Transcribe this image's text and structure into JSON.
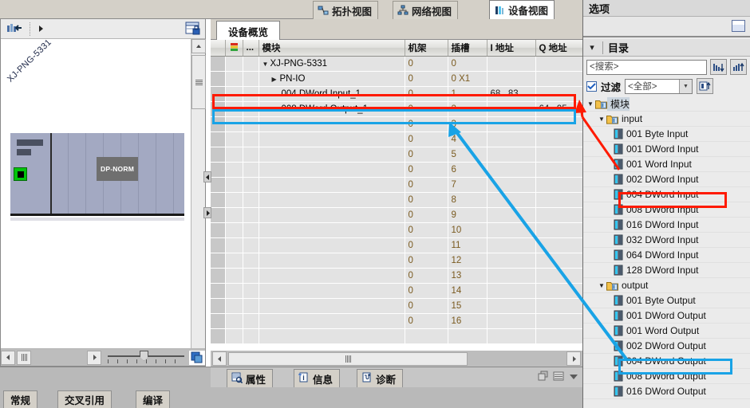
{
  "view_tabs": [
    {
      "label": "拓扑视图",
      "icon": "topology-icon",
      "active": false
    },
    {
      "label": "网络视图",
      "icon": "network-icon",
      "active": false
    },
    {
      "label": "设备视图",
      "icon": "device-icon",
      "active": true
    }
  ],
  "left_pane": {
    "toolbar": {
      "device_select_icon": "device-select-icon",
      "expand_arrow_icon": "right-arrow-icon",
      "lock_icon": "window-lock-icon"
    },
    "device_label": "XJ-PNG-5331",
    "module_label": "DP-NORM",
    "zoom_slider_value": "100"
  },
  "center": {
    "tab_label": "设备概览",
    "columns": [
      {
        "key": "gutter",
        "label": ""
      },
      {
        "key": "flag",
        "label": "",
        "icon": "traffic-light-icon"
      },
      {
        "key": "dots",
        "label": "..."
      },
      {
        "key": "module",
        "label": "模块"
      },
      {
        "key": "rack",
        "label": "机架"
      },
      {
        "key": "slot",
        "label": "插槽"
      },
      {
        "key": "iaddr",
        "label": "I 地址"
      },
      {
        "key": "qaddr",
        "label": "Q 地址"
      }
    ],
    "rows": [
      {
        "module": "XJ-PNG-5331",
        "rack": "0",
        "slot": "0",
        "iaddr": "",
        "qaddr": "",
        "indent": 1,
        "toggle": "expanded",
        "highlight": "none"
      },
      {
        "module": "PN-IO",
        "rack": "0",
        "slot": "0 X1",
        "iaddr": "",
        "qaddr": "",
        "indent": 2,
        "toggle": "collapsed",
        "highlight": "none"
      },
      {
        "module": "004 DWord Input_1",
        "rack": "0",
        "slot": "1",
        "iaddr": "68...83",
        "qaddr": "",
        "indent": 3,
        "toggle": "none",
        "highlight": "red"
      },
      {
        "module": "008 DWord Output_1",
        "rack": "0",
        "slot": "2",
        "iaddr": "",
        "qaddr": "64...95",
        "indent": 3,
        "toggle": "none",
        "highlight": "blue"
      },
      {
        "module": "",
        "rack": "0",
        "slot": "3",
        "iaddr": "",
        "qaddr": "",
        "indent": 3,
        "toggle": "none",
        "highlight": "none"
      },
      {
        "module": "",
        "rack": "0",
        "slot": "4",
        "iaddr": "",
        "qaddr": "",
        "indent": 3,
        "toggle": "none",
        "highlight": "none"
      },
      {
        "module": "",
        "rack": "0",
        "slot": "5",
        "iaddr": "",
        "qaddr": "",
        "indent": 3,
        "toggle": "none",
        "highlight": "none"
      },
      {
        "module": "",
        "rack": "0",
        "slot": "6",
        "iaddr": "",
        "qaddr": "",
        "indent": 3,
        "toggle": "none",
        "highlight": "none"
      },
      {
        "module": "",
        "rack": "0",
        "slot": "7",
        "iaddr": "",
        "qaddr": "",
        "indent": 3,
        "toggle": "none",
        "highlight": "none"
      },
      {
        "module": "",
        "rack": "0",
        "slot": "8",
        "iaddr": "",
        "qaddr": "",
        "indent": 3,
        "toggle": "none",
        "highlight": "none"
      },
      {
        "module": "",
        "rack": "0",
        "slot": "9",
        "iaddr": "",
        "qaddr": "",
        "indent": 3,
        "toggle": "none",
        "highlight": "none"
      },
      {
        "module": "",
        "rack": "0",
        "slot": "10",
        "iaddr": "",
        "qaddr": "",
        "indent": 3,
        "toggle": "none",
        "highlight": "none"
      },
      {
        "module": "",
        "rack": "0",
        "slot": "11",
        "iaddr": "",
        "qaddr": "",
        "indent": 3,
        "toggle": "none",
        "highlight": "none"
      },
      {
        "module": "",
        "rack": "0",
        "slot": "12",
        "iaddr": "",
        "qaddr": "",
        "indent": 3,
        "toggle": "none",
        "highlight": "none"
      },
      {
        "module": "",
        "rack": "0",
        "slot": "13",
        "iaddr": "",
        "qaddr": "",
        "indent": 3,
        "toggle": "none",
        "highlight": "none"
      },
      {
        "module": "",
        "rack": "0",
        "slot": "14",
        "iaddr": "",
        "qaddr": "",
        "indent": 3,
        "toggle": "none",
        "highlight": "none"
      },
      {
        "module": "",
        "rack": "0",
        "slot": "15",
        "iaddr": "",
        "qaddr": "",
        "indent": 3,
        "toggle": "none",
        "highlight": "none"
      },
      {
        "module": "",
        "rack": "0",
        "slot": "16",
        "iaddr": "",
        "qaddr": "",
        "indent": 3,
        "toggle": "none",
        "highlight": "none"
      },
      {
        "module": "",
        "rack": "",
        "slot": "",
        "iaddr": "",
        "qaddr": "",
        "indent": 3,
        "toggle": "none",
        "highlight": "none"
      }
    ]
  },
  "right_panel": {
    "options_title": "选项",
    "catalog_title": "目录",
    "search_placeholder": "<搜索>",
    "search_value": "<搜索>",
    "filter_label": "过滤",
    "filter_checked": true,
    "filter_value": "<全部>",
    "buttons": {
      "sort_desc_icon": "sort-descending-icon",
      "sort_asc_icon": "sort-ascending-icon",
      "filter_config_icon": "filter-config-icon",
      "window_restore_icon": "window-restore-icon"
    },
    "tree": [
      {
        "label": "模块",
        "level": 0,
        "type": "folder",
        "toggle": "expanded",
        "selected": true,
        "highlight": "none"
      },
      {
        "label": "input",
        "level": 1,
        "type": "folder",
        "toggle": "expanded",
        "selected": false,
        "highlight": "none"
      },
      {
        "label": "001 Byte Input",
        "level": 2,
        "type": "module",
        "toggle": "none",
        "selected": false,
        "highlight": "none"
      },
      {
        "label": "001 DWord Input",
        "level": 2,
        "type": "module",
        "toggle": "none",
        "selected": false,
        "highlight": "none"
      },
      {
        "label": "001 Word Input",
        "level": 2,
        "type": "module",
        "toggle": "none",
        "selected": false,
        "highlight": "none"
      },
      {
        "label": "002 DWord Input",
        "level": 2,
        "type": "module",
        "toggle": "none",
        "selected": false,
        "highlight": "none"
      },
      {
        "label": "004 DWord Input",
        "level": 2,
        "type": "module",
        "toggle": "none",
        "selected": false,
        "highlight": "red"
      },
      {
        "label": "008 DWord Input",
        "level": 2,
        "type": "module",
        "toggle": "none",
        "selected": false,
        "highlight": "none"
      },
      {
        "label": "016 DWord Input",
        "level": 2,
        "type": "module",
        "toggle": "none",
        "selected": false,
        "highlight": "none"
      },
      {
        "label": "032 DWord Input",
        "level": 2,
        "type": "module",
        "toggle": "none",
        "selected": false,
        "highlight": "none"
      },
      {
        "label": "064 DWord Input",
        "level": 2,
        "type": "module",
        "toggle": "none",
        "selected": false,
        "highlight": "none"
      },
      {
        "label": "128 DWord Input",
        "level": 2,
        "type": "module",
        "toggle": "none",
        "selected": false,
        "highlight": "none"
      },
      {
        "label": "output",
        "level": 1,
        "type": "folder",
        "toggle": "expanded",
        "selected": false,
        "highlight": "none"
      },
      {
        "label": "001 Byte Output",
        "level": 2,
        "type": "module",
        "toggle": "none",
        "selected": false,
        "highlight": "none"
      },
      {
        "label": "001 DWord Output",
        "level": 2,
        "type": "module",
        "toggle": "none",
        "selected": false,
        "highlight": "none"
      },
      {
        "label": "001 Word Output",
        "level": 2,
        "type": "module",
        "toggle": "none",
        "selected": false,
        "highlight": "none"
      },
      {
        "label": "002 DWord Output",
        "level": 2,
        "type": "module",
        "toggle": "none",
        "selected": false,
        "highlight": "none"
      },
      {
        "label": "004 DWord Output",
        "level": 2,
        "type": "module",
        "toggle": "none",
        "selected": false,
        "highlight": "blue"
      },
      {
        "label": "008 DWord Output",
        "level": 2,
        "type": "module",
        "toggle": "none",
        "selected": false,
        "highlight": "none"
      },
      {
        "label": "016 DWord Output",
        "level": 2,
        "type": "module",
        "toggle": "none",
        "selected": false,
        "highlight": "none"
      }
    ]
  },
  "bottom": {
    "tabs": [
      {
        "label": "属性",
        "icon": "properties-icon"
      },
      {
        "label": "信息",
        "icon": "info-icon"
      },
      {
        "label": "诊断",
        "icon": "diagnostics-icon"
      }
    ],
    "left_tabs": [
      {
        "label": "常规",
        "active": true
      },
      {
        "label": "交叉引用",
        "active": false
      },
      {
        "label": "编译",
        "active": false
      }
    ],
    "controls": {
      "restore_icon": "restore-icon",
      "list_icon": "list-icon",
      "dropdown_icon": "chevron-down-icon"
    }
  },
  "annotations": {
    "red_color": "#ff1a00",
    "blue_color": "#19a3e6",
    "red_arrow": "Connects 004 DWord Input catalog entry to 004 DWord Input_1 table row",
    "blue_arrow": "Connects 004 DWord Output catalog entry to 008 DWord Output_1 table row"
  }
}
